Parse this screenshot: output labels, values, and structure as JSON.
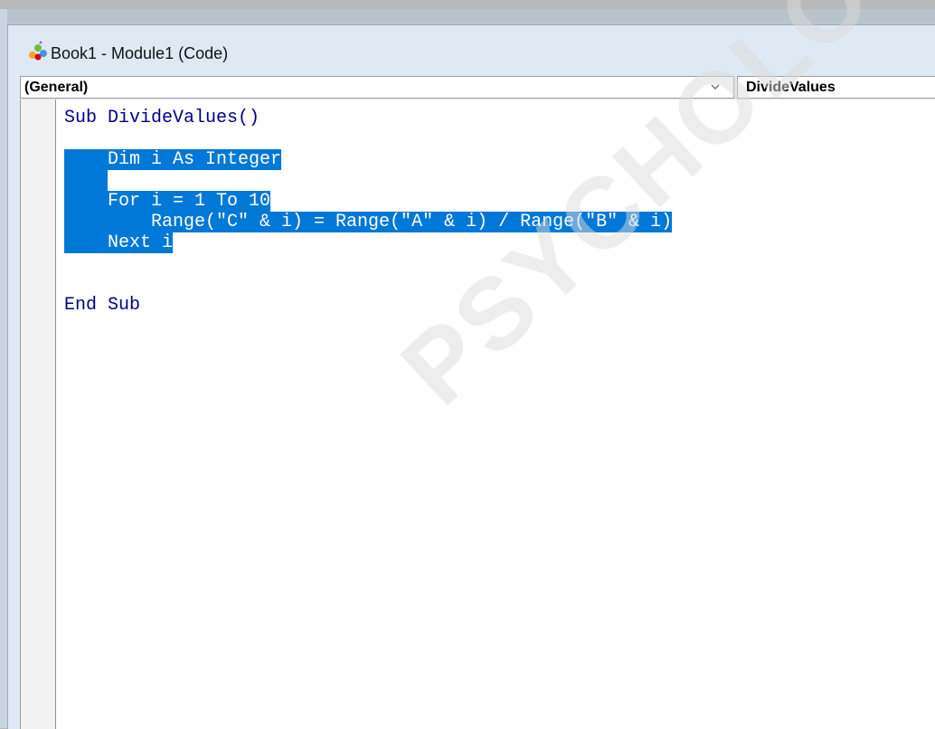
{
  "window": {
    "title": "Book1 - Module1 (Code)",
    "icon": "vba-module-icon"
  },
  "object_combo": {
    "value": "(General)"
  },
  "procedure_combo": {
    "value": "DivideValues"
  },
  "code": {
    "lines": [
      "Sub DivideValues()",
      "",
      "    Dim i As Integer",
      "    ",
      "    For i = 1 To 10",
      "        Range(\"C\" & i) = Range(\"A\" & i) / Range(\"B\" & i)",
      "    Next i",
      "",
      "End Sub"
    ],
    "selected_lines": [
      2,
      3,
      4,
      5,
      6
    ]
  },
  "watermark": {
    "text": "PSYCHOLOGY.C"
  },
  "colors": {
    "selection": "#0078d7",
    "keyword": "#00008b"
  }
}
